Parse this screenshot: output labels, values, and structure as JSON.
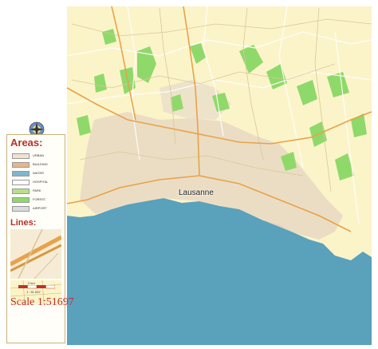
{
  "map": {
    "city_label": "Lausanne",
    "colors": {
      "land": "#fbf4c9",
      "urban": "#e7d8c2",
      "forest": "#8fd96a",
      "water": "#5aa1bb",
      "road_major": "#e8a24a",
      "road_minor": "#d8c79a",
      "border": "#ffffff"
    }
  },
  "legend": {
    "areas_title": "Areas:",
    "areas": [
      {
        "label": "URBAN",
        "color": "#efe3d0"
      },
      {
        "label": "BUILDING",
        "color": "#e9b48e"
      },
      {
        "label": "WATER",
        "color": "#7fb6cf"
      },
      {
        "label": "HOSPITAL",
        "color": "#ffffff"
      },
      {
        "label": "PARK",
        "color": "#b8e08a"
      },
      {
        "label": "FOREST",
        "color": "#8fd96a"
      },
      {
        "label": "AIRPORT",
        "color": "#dcdcdc"
      }
    ],
    "lines_title": "Lines:",
    "scalebar_label": "2 km",
    "scalebar_ratio": "1 : 51 697",
    "scale_text": "Scale  1:51697"
  }
}
